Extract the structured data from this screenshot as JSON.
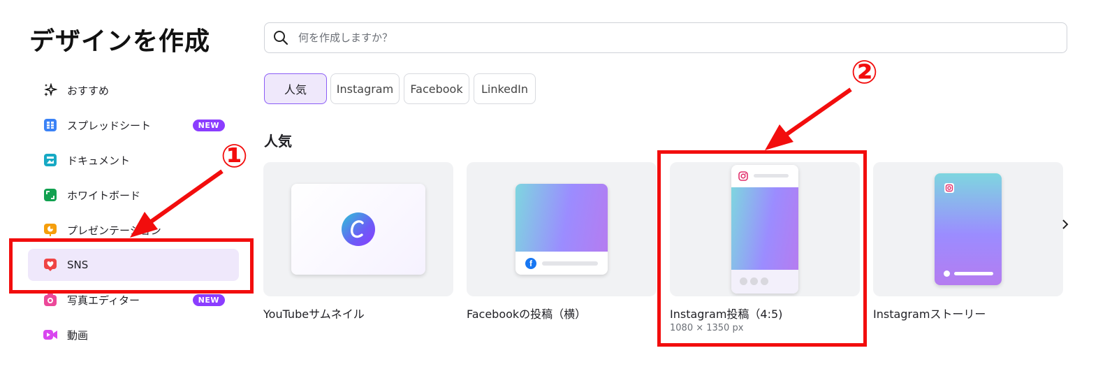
{
  "page": {
    "title": "デザインを作成"
  },
  "search": {
    "placeholder": "何を作成しますか？"
  },
  "sidebar": {
    "items": [
      {
        "label": "おすすめ",
        "icon": "sparkle-icon"
      },
      {
        "label": "スプレッドシート",
        "icon": "spreadsheet-icon",
        "badge": "NEW"
      },
      {
        "label": "ドキュメント",
        "icon": "document-icon"
      },
      {
        "label": "ホワイトボード",
        "icon": "whiteboard-icon"
      },
      {
        "label": "プレゼンテーション",
        "icon": "presentation-icon"
      },
      {
        "label": "SNS",
        "icon": "heart-icon",
        "active": true
      },
      {
        "label": "写真エディター",
        "icon": "camera-icon",
        "badge": "NEW"
      },
      {
        "label": "動画",
        "icon": "video-icon"
      }
    ]
  },
  "tabs": [
    {
      "label": "人気",
      "active": true
    },
    {
      "label": "Instagram"
    },
    {
      "label": "Facebook"
    },
    {
      "label": "LinkedIn"
    }
  ],
  "section": {
    "title": "人気"
  },
  "cards": [
    {
      "label": "YouTubeサムネイル"
    },
    {
      "label": "Facebookの投稿（横）"
    },
    {
      "label": "Instagram投稿（4:5)",
      "sub": "1080 × 1350 px"
    },
    {
      "label": "Instagramストーリー"
    }
  ],
  "annotations": {
    "one": "①",
    "two": "②"
  },
  "colors": {
    "accent": "#8b3dff",
    "annotation": "#f20d0d",
    "active_bg": "#efe8fb"
  }
}
